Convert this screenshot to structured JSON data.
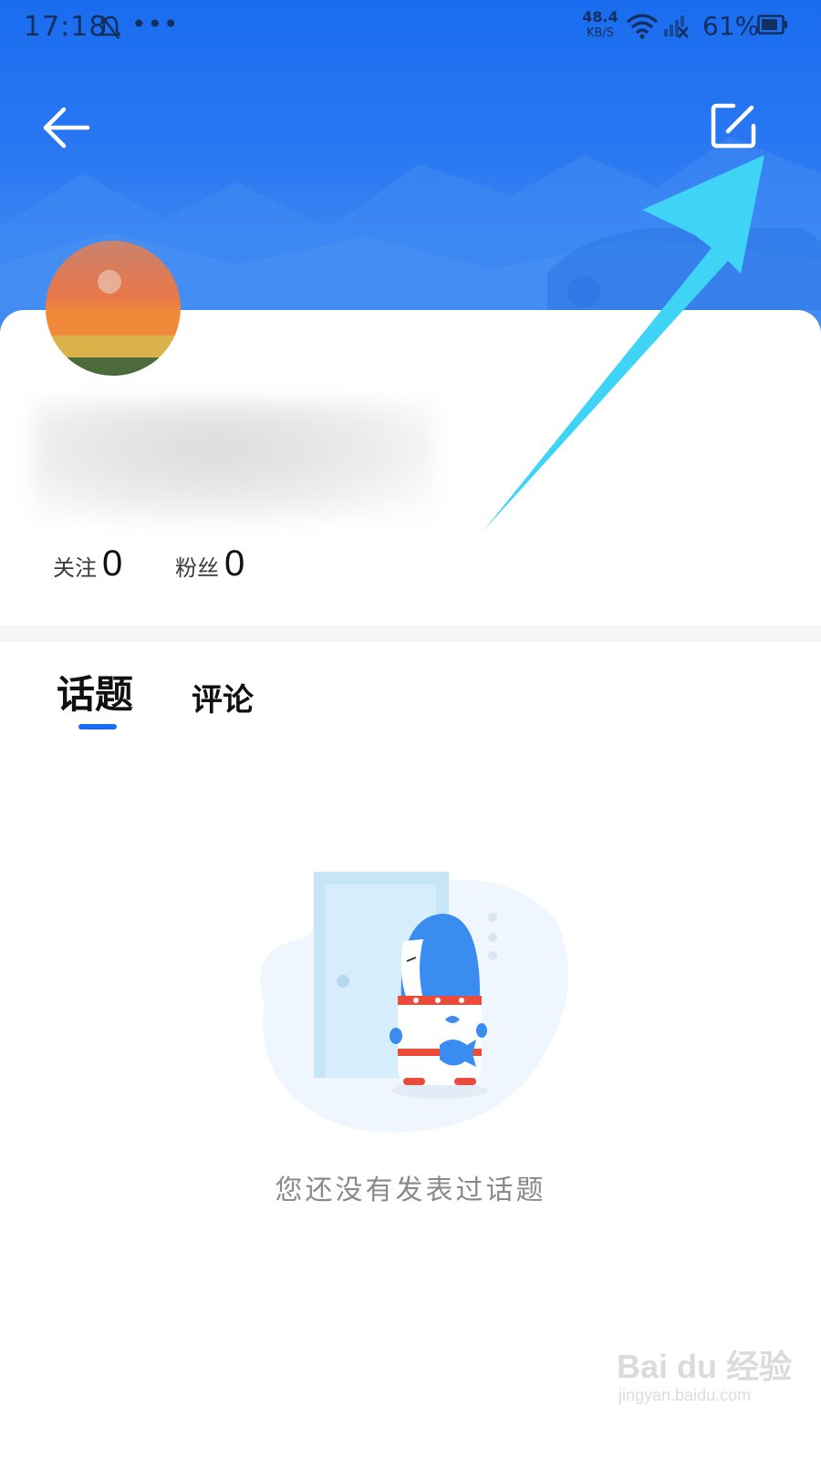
{
  "status_bar": {
    "time": "17:18",
    "more": "•••",
    "net_speed_value": "48.4",
    "net_speed_unit": "KB/S",
    "battery": "61%"
  },
  "header": {
    "back_icon": "arrow-left-icon",
    "edit_icon": "edit-square-icon"
  },
  "profile": {
    "stats": [
      {
        "label": "关注",
        "value": "0"
      },
      {
        "label": "粉丝",
        "value": "0"
      }
    ]
  },
  "tabs": [
    {
      "label": "话题",
      "active": true
    },
    {
      "label": "评论",
      "active": false
    }
  ],
  "empty_state": {
    "message": "您还没有发表过话题"
  },
  "watermark": {
    "brand": "Bai du 经验",
    "url": "jingyan.baidu.com"
  },
  "colors": {
    "accent": "#1a6cf0",
    "header_blue": "#2a78f2",
    "annotation_arrow": "#3fd3f5"
  }
}
